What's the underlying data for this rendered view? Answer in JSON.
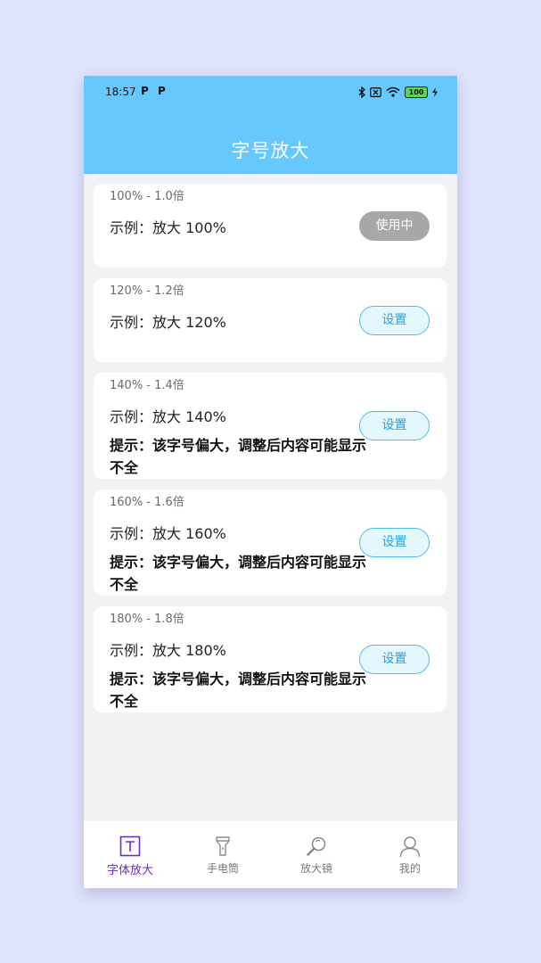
{
  "status_bar": {
    "time": "18:57",
    "notif1": "P",
    "notif2": "P",
    "battery": "100"
  },
  "header": {
    "title": "字号放大"
  },
  "cards": [
    {
      "scale": "100% - 1.0倍",
      "example": "示例：放大 100%",
      "tip": "",
      "button": "使用中",
      "state": "active"
    },
    {
      "scale": "120% - 1.2倍",
      "example": "示例：放大 120%",
      "tip": "",
      "button": "设置",
      "state": "set"
    },
    {
      "scale": "140% - 1.4倍",
      "example": "示例：放大 140%",
      "tip": "提示：该字号偏大，调整后内容可能显示不全",
      "button": "设置",
      "state": "set"
    },
    {
      "scale": "160% - 1.6倍",
      "example": "示例：放大 160%",
      "tip": "提示：该字号偏大，调整后内容可能显示不全",
      "button": "设置",
      "state": "set"
    },
    {
      "scale": "180% - 1.8倍",
      "example": "示例：放大 180%",
      "tip": "提示：该字号偏大，调整后内容可能显示不全",
      "button": "设置",
      "state": "set"
    }
  ],
  "tabbar": {
    "items": [
      {
        "label": "字体放大",
        "icon": "font-icon",
        "active": true
      },
      {
        "label": "手电筒",
        "icon": "flashlight-icon",
        "active": false
      },
      {
        "label": "放大镜",
        "icon": "magnifier-icon",
        "active": false
      },
      {
        "label": "我的",
        "icon": "profile-icon",
        "active": false
      }
    ]
  },
  "colors": {
    "header": "#67c8fd",
    "accent_tab": "#6a2fb5",
    "button_border": "#4fbce8",
    "button_text": "#19a7e8",
    "active_button": "#a7a7a7"
  }
}
